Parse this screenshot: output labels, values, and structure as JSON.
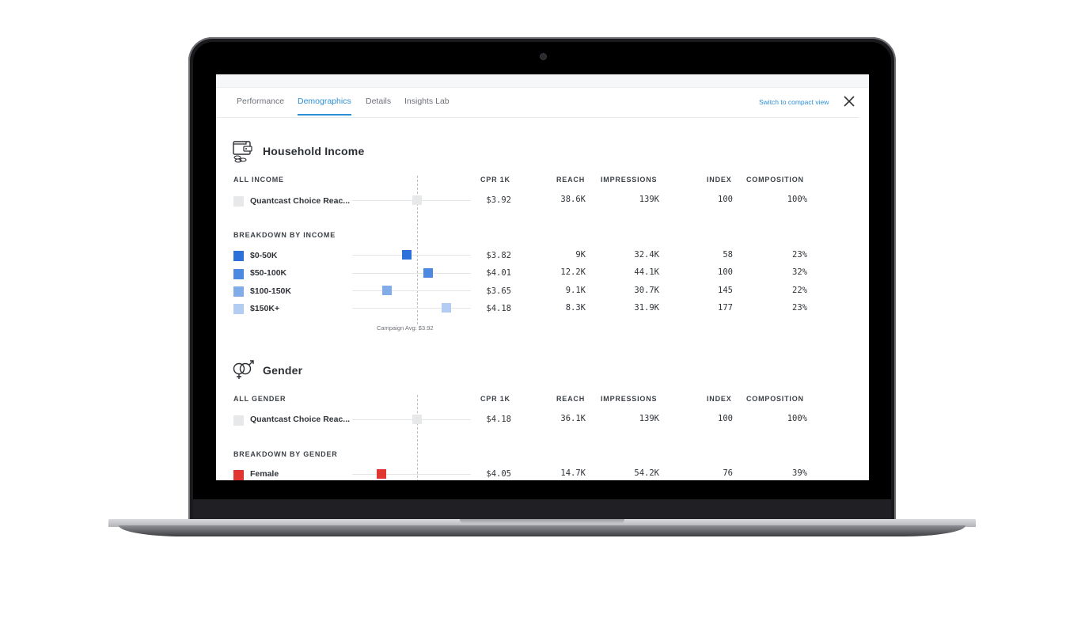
{
  "tabs": [
    {
      "label": "Performance",
      "active": false
    },
    {
      "label": "Demographics",
      "active": true
    },
    {
      "label": "Details",
      "active": false
    },
    {
      "label": "Insights Lab",
      "active": false
    }
  ],
  "compact_view_link": "Switch to compact view",
  "columns": [
    "CPR 1K",
    "REACH",
    "IMPRESSIONS",
    "INDEX",
    "COMPOSITION"
  ],
  "colors": {
    "accent": "#2d8fd5",
    "income_0_50k": "#2b71d9",
    "income_50_100k": "#4c89e0",
    "income_100_150k": "#82abe9",
    "income_150k_plus": "#b3cdf2",
    "female": "#e1352f",
    "all_swatch": "#e7e8ea"
  },
  "household_income": {
    "icon": "wallet-coins-icon",
    "title": "Household Income",
    "all_label": "ALL INCOME",
    "all_row": {
      "label": "Quantcast Choice Reac...",
      "cpr": "$3.92",
      "reach": "38.6K",
      "impressions": "139K",
      "index": "100",
      "composition": "100%"
    },
    "breakdown_label": "BREAKDOWN BY INCOME",
    "rows": [
      {
        "label": "$0-50K",
        "cpr": "$3.82",
        "reach": "9K",
        "impressions": "32.4K",
        "index": "58",
        "composition": "23%"
      },
      {
        "label": "$50-100K",
        "cpr": "$4.01",
        "reach": "12.2K",
        "impressions": "44.1K",
        "index": "100",
        "composition": "32%"
      },
      {
        "label": "$100-150K",
        "cpr": "$3.65",
        "reach": "9.1K",
        "impressions": "30.7K",
        "index": "145",
        "composition": "22%"
      },
      {
        "label": "$150K+",
        "cpr": "$4.18",
        "reach": "8.3K",
        "impressions": "31.9K",
        "index": "177",
        "composition": "23%"
      }
    ],
    "avg_caption": "Campaign Avg: $3.92"
  },
  "gender": {
    "icon": "gender-symbols-icon",
    "title": "Gender",
    "all_label": "ALL GENDER",
    "all_row": {
      "label": "Quantcast Choice Reac...",
      "cpr": "$4.18",
      "reach": "36.1K",
      "impressions": "139K",
      "index": "100",
      "composition": "100%"
    },
    "breakdown_label": "BREAKDOWN BY GENDER",
    "rows": [
      {
        "label": "Female",
        "cpr": "$4.05",
        "reach": "14.7K",
        "impressions": "54.2K",
        "index": "76",
        "composition": "39%"
      }
    ]
  }
}
